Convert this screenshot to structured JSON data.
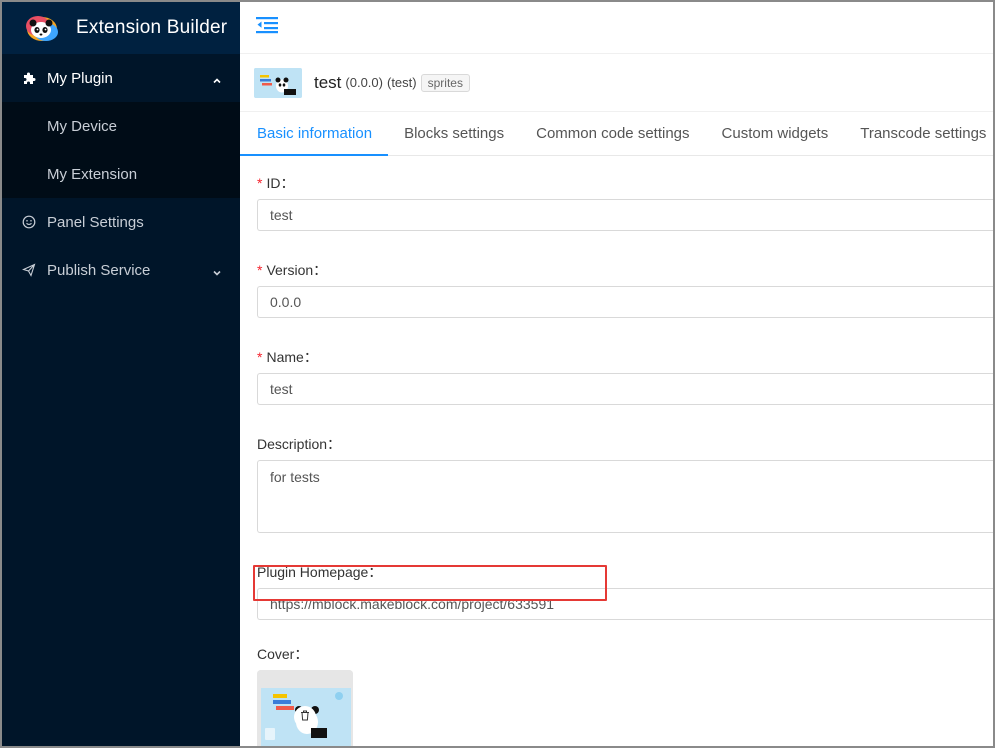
{
  "app": {
    "title": "Extension Builder"
  },
  "sidebar": {
    "items": [
      {
        "label": "My Plugin",
        "icon": "puzzle-icon",
        "expanded": true,
        "children": [
          {
            "label": "My Device"
          },
          {
            "label": "My Extension"
          }
        ]
      },
      {
        "label": "Panel Settings",
        "icon": "smile-icon"
      },
      {
        "label": "Publish Service",
        "icon": "send-icon"
      }
    ]
  },
  "header": {
    "name": "test",
    "version": "(0.0.0)",
    "id": "(test)",
    "tag": "sprites"
  },
  "tabs": [
    {
      "label": "Basic information",
      "active": true
    },
    {
      "label": "Blocks settings"
    },
    {
      "label": "Common code settings"
    },
    {
      "label": "Custom widgets"
    },
    {
      "label": "Transcode settings"
    }
  ],
  "form": {
    "id": {
      "label": "ID",
      "value": "test",
      "required": true
    },
    "version": {
      "label": "Version",
      "value": "0.0.0",
      "required": true
    },
    "name": {
      "label": "Name",
      "value": "test",
      "required": true
    },
    "description": {
      "label": "Description",
      "value": "for tests"
    },
    "homepage": {
      "label": "Plugin Homepage",
      "value": "https://mblock.makeblock.com/project/633591"
    },
    "cover": {
      "label": "Cover"
    },
    "colon": "："
  },
  "colors": {
    "accent": "#1890ff",
    "sidebar": "#001529",
    "required": "#f5222d",
    "highlight": "#e53935"
  }
}
